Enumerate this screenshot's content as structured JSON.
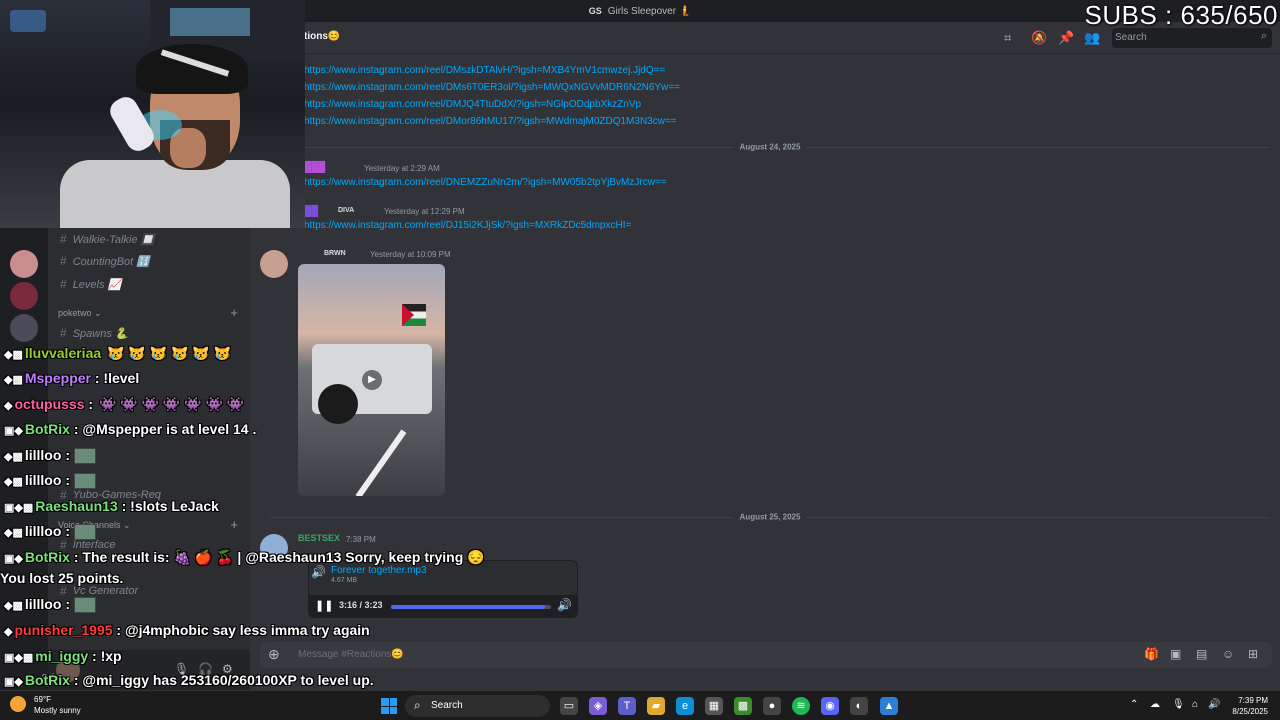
{
  "titlebar": {
    "server_tag": "GS",
    "server_name": "Girls Sleepover 🧜"
  },
  "overlay": {
    "subs": "SUBS : 635/650"
  },
  "header": {
    "channel_name": "tions😊",
    "search_placeholder": "Search"
  },
  "sidebar": {
    "channels": [
      {
        "name": "Walkie-Talkie 🔲"
      },
      {
        "name": "CountingBot 🔢"
      },
      {
        "name": "Levels 📈"
      },
      {
        "name": "Spawns 🐍"
      },
      {
        "name": "Yubo-Games-Req"
      },
      {
        "name": "Interface"
      },
      {
        "name": "Vc Generator"
      }
    ],
    "category_poketwo": "poketwo",
    "category_voice": "Voice Channels",
    "user_status": "Online"
  },
  "messages": {
    "links_top": [
      "https://www.instagram.com/reel/DMszkDTAlvH/?igsh=MXB4YmV1cmwzej.JjdQ==",
      "https://www.instagram.com/reel/DMs6T0ER3ol/?igsh=MWQxNGVvMDR6N2N6Yw==",
      "https://www.instagram.com/reel/DMJQ4TtuDdX/?igsh=NGlpODdpbXkzZnVp",
      "https://www.instagram.com/reel/DMor86hMU17/?igsh=MWdmajM0ZDQ1M3N3cw=="
    ],
    "date1": "August 24, 2025",
    "msg1": {
      "time": "Yesterday at 2:29 AM",
      "link": "https://www.instagram.com/reel/DNEMZZuNn2m/?igsh=MW05b2tpYjBvMzJrcw=="
    },
    "msg2": {
      "tag": "DIVA",
      "time": "Yesterday at 12:29 PM",
      "link": "https://www.instagram.com/reel/DJ15i2KJjSk/?igsh=MXRkZDc5dmpxcHI="
    },
    "msg3": {
      "tag": "BRWN",
      "time": "Yesterday at 10:09 PM"
    },
    "date2": "August 25, 2025",
    "msg4": {
      "author": "BESTSEX",
      "time": "7:38 PM",
      "file_name": "Forever together.mp3",
      "file_size": "4.67 MB",
      "player_time": "3:16 / 3:23",
      "progress": 0.965
    },
    "composer_placeholder": "Message #Reactions😊"
  },
  "chat": [
    {
      "user": "lluvvaleriaa",
      "color": "#9acd32",
      "text": "",
      "emotes": "😿 😿 😿 😿 😿 😿"
    },
    {
      "user": "Mspepper",
      "color": "#c27cff",
      "text": ": !level",
      "emotes": ""
    },
    {
      "user": "octupusss",
      "color": "#ff5fa2",
      "text": ":",
      "emotes": "👾 👾 👾 👾 👾 👾 👾"
    },
    {
      "user": "BotRix",
      "color": "#7ee07e",
      "text": ": @Mspepper is at level 14 .",
      "emotes": ""
    },
    {
      "user": "lillloo",
      "color": "#ffffff",
      "text": ":",
      "emotes": ""
    },
    {
      "user": "lillloo",
      "color": "#ffffff",
      "text": ":",
      "emotes": ""
    },
    {
      "user": "Raeshaun13",
      "color": "#7ee07e",
      "text": ": !slots LeJack",
      "emotes": ""
    },
    {
      "user": "lillloo",
      "color": "#ffffff",
      "text": ":",
      "emotes": ""
    },
    {
      "user": "BotRix",
      "color": "#7ee07e",
      "text": ": The result is: 🍇 🍎 🍒 | @Raeshaun13 Sorry, keep trying 😔",
      "emotes": ""
    },
    {
      "user": "",
      "color": "#ffffff",
      "text": "You lost 25 points.",
      "emotes": ""
    },
    {
      "user": "lillloo",
      "color": "#ffffff",
      "text": ":",
      "emotes": ""
    },
    {
      "user": "punisher_1995",
      "color": "#ff3b3b",
      "text": ": @j4mphobic say less imma try again",
      "emotes": ""
    },
    {
      "user": "mi_iggy",
      "color": "#7ee07e",
      "text": ": !xp",
      "emotes": ""
    },
    {
      "user": "BotRix",
      "color": "#7ee07e",
      "text": ": @mi_iggy has 253160/260100XP to level up.",
      "emotes": ""
    }
  ],
  "taskbar": {
    "weather_temp": "69°F",
    "weather_desc": "Mostly sunny",
    "search": "Search",
    "time": "7:39 PM",
    "date": "8/25/2025"
  },
  "colors": {
    "link": "#00a8fc",
    "accent": "#5865f2",
    "bg": "#313338"
  }
}
